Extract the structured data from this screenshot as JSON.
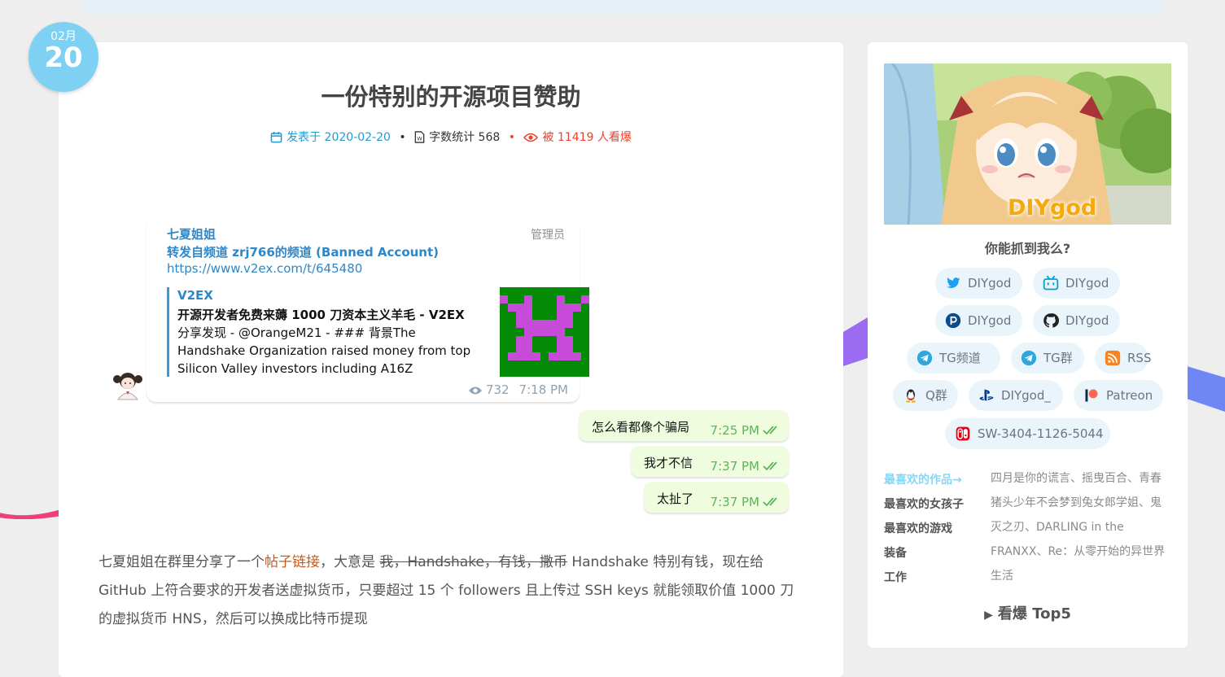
{
  "date": {
    "month": "02月",
    "day": "20"
  },
  "post": {
    "title": "一份特别的开源项目赞助",
    "meta": {
      "posted_label": "发表于 2020-02-20",
      "wordcount_label": "字数统计 568",
      "views_label": "被 11419 人看爆",
      "separator": "•"
    },
    "body": {
      "p1": "七夏姐姐在群里分享了一个",
      "link": "帖子链接",
      "p2": "，大意是 ",
      "strike": "我，Handshake，有钱，撒币",
      "p3": " Handshake 特别有钱，现在给 GitHub 上符合要求的开发者送虚拟货币，只要超过 15 个 followers 且上传过 SSH keys 就能领取价值 1000 刀的虚拟货币 HNS，然后可以换成比特币提现"
    }
  },
  "telegram": {
    "sender": "七夏姐姐",
    "role": "管理员",
    "forwarded": "转发自频道 zrj766的频道 (Banned Account)",
    "link": "https://www.v2ex.com/t/645480",
    "preview": {
      "site": "V2EX",
      "title": "开源开发者免费来薅 1000 刀资本主义羊毛 - V2EX",
      "desc": "分享发现 - @OrangeM21 - ### 背景The Handshake Organization raised money from top Silicon Valley investors including A16Z"
    },
    "views": "732",
    "time": "7:18 PM",
    "replies": [
      {
        "text": "怎么看都像个骗局",
        "time": "7:25 PM"
      },
      {
        "text": "我才不信",
        "time": "7:37 PM"
      },
      {
        "text": "太扯了",
        "time": "7:37 PM"
      }
    ]
  },
  "sidebar": {
    "banner_text": "DIYgod",
    "question": "你能抓到我么?",
    "links": [
      {
        "icon": "twitter-icon",
        "label": "DIYgod"
      },
      {
        "icon": "bilibili-icon",
        "label": "DIYgod"
      },
      {
        "icon": "pixiv-icon",
        "label": "DIYgod"
      },
      {
        "icon": "github-icon",
        "label": "DIYgod"
      },
      {
        "icon": "telegram-icon",
        "label": "TG频道"
      },
      {
        "icon": "telegram-icon",
        "label": "TG群"
      },
      {
        "icon": "rss-icon",
        "label": "RSS"
      },
      {
        "icon": "qq-icon",
        "label": "Q群"
      },
      {
        "icon": "playstation-icon",
        "label": "DIYgod_"
      },
      {
        "icon": "patreon-icon",
        "label": "Patreon"
      },
      {
        "icon": "nintendo-switch-icon",
        "label": "SW-3404-1126-5044"
      }
    ],
    "favorites": {
      "keys": [
        "最喜欢的作品→",
        "最喜欢的女孩子",
        "最喜欢的游戏",
        "装备",
        "工作"
      ],
      "value": "四月是你的谎言、摇曳百合、青春猪头少年不会梦到兔女郎学姐、鬼灭之刃、DARLING in the FRANXX、Re：从零开始的异世界生活"
    },
    "top5_label": "看爆 Top5",
    "top5_triangle": "▶"
  },
  "colors": {
    "accent": "#1e9bd5",
    "views_red": "#e8432d",
    "date_badge": "#7fd1f4",
    "telegram_link": "#2d87c8",
    "reply_bubble": "#effdde",
    "reply_time": "#5db55a",
    "banner_name": "#f6a80f"
  }
}
